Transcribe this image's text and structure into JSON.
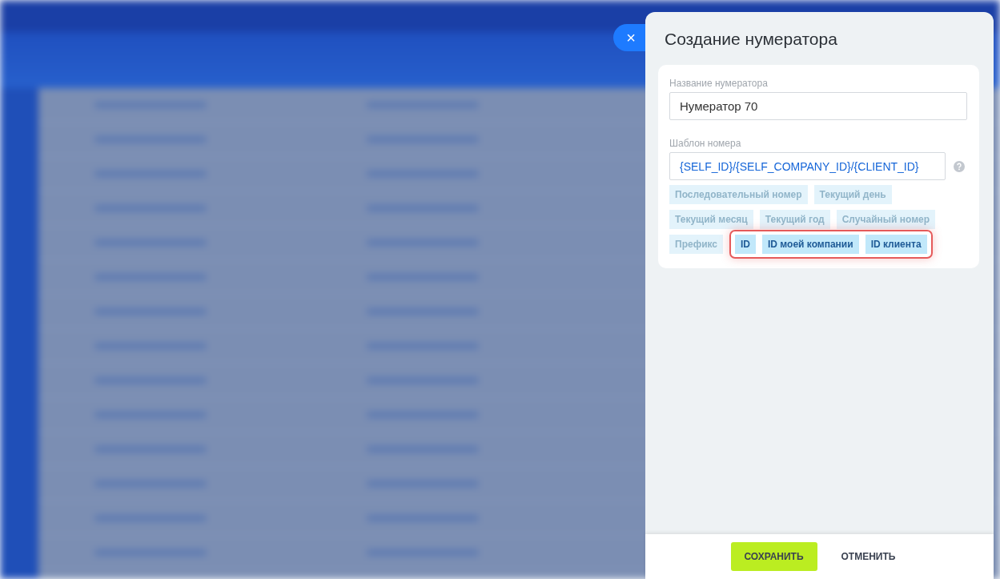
{
  "panel": {
    "title": "Создание нумератора",
    "close_icon": "×"
  },
  "name_field": {
    "label": "Название нумератора",
    "value": "Нумератор 70"
  },
  "template_field": {
    "label": "Шаблон номера",
    "value": "{SELF_ID}/{SELF_COMPANY_ID}/{CLIENT_ID}"
  },
  "tag_rows": [
    [
      {
        "label": "Последовательный номер",
        "highlighted": false
      },
      {
        "label": "Текущий день",
        "highlighted": false
      }
    ],
    [
      {
        "label": "Текущий месяц",
        "highlighted": false
      },
      {
        "label": "Текущий год",
        "highlighted": false
      },
      {
        "label": "Случайный номер",
        "highlighted": false
      }
    ],
    [
      {
        "label": "Префикс",
        "highlighted": false
      },
      {
        "label": "ID",
        "highlighted": true
      },
      {
        "label": "ID моей компании",
        "highlighted": true
      },
      {
        "label": "ID клиента",
        "highlighted": true
      }
    ]
  ],
  "buttons": [
    {
      "label": "СОХРАНИТЬ",
      "kind": "primary"
    },
    {
      "label": "ОТМЕНИТЬ",
      "kind": "link"
    }
  ]
}
